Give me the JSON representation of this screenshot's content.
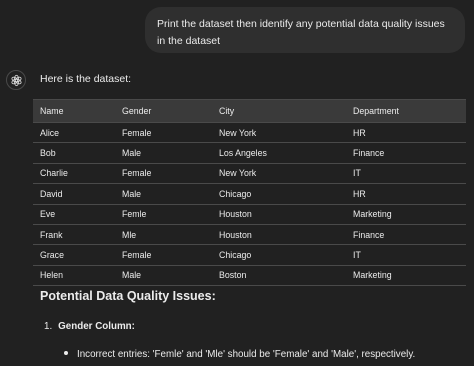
{
  "user_message": {
    "text": "Print the dataset then identify any potential data quality issues in the dataset"
  },
  "assistant": {
    "intro": "Here is the dataset:",
    "table": {
      "headers": [
        "Name",
        "Gender",
        "City",
        "Department"
      ],
      "rows": [
        [
          "Alice",
          "Female",
          "New York",
          "HR"
        ],
        [
          "Bob",
          "Male",
          "Los Angeles",
          "Finance"
        ],
        [
          "Charlie",
          "Female",
          "New York",
          "IT"
        ],
        [
          "David",
          "Male",
          "Chicago",
          "HR"
        ],
        [
          "Eve",
          "Femle",
          "Houston",
          "Marketing"
        ],
        [
          "Frank",
          "Mle",
          "Houston",
          "Finance"
        ],
        [
          "Grace",
          "Female",
          "Chicago",
          "IT"
        ],
        [
          "Helen",
          "Male",
          "Boston",
          "Marketing"
        ]
      ]
    },
    "section_heading": "Potential Data Quality Issues:",
    "issues": [
      {
        "number": "1.",
        "label": "Gender Column:",
        "bullets": [
          "Incorrect entries: 'Femle' and 'Mle' should be 'Female' and 'Male', respectively."
        ]
      }
    ]
  },
  "icons": {
    "assistant_avatar": "openai-logo-icon"
  }
}
